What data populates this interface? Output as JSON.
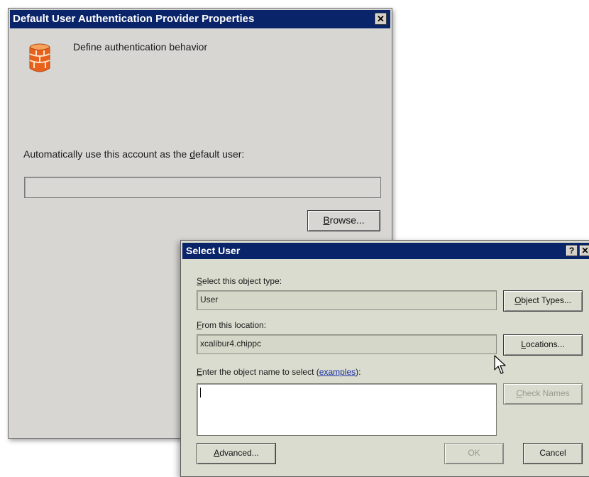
{
  "outer_dialog": {
    "title": "Default User Authentication Provider Properties",
    "close_glyph": "✕",
    "icon": "firewall-brick-icon",
    "description": "Define authentication behavior",
    "account_label_pre": "Automatically use this account as the ",
    "account_label_key": "d",
    "account_label_post": "efault user:",
    "account_value": "",
    "browse_key": "B",
    "browse_rest": "rowse..."
  },
  "select_user_dialog": {
    "title": "Select User",
    "help_glyph": "?",
    "close_glyph": "✕",
    "object_type_label_key": "S",
    "object_type_label_rest": "elect this object type:",
    "object_type_value": "User",
    "object_types_key": "O",
    "object_types_rest": "bject Types...",
    "location_label_key": "F",
    "location_label_rest": "rom this location:",
    "location_value": "xcalibur4.chippc",
    "locations_key": "L",
    "locations_rest": "ocations...",
    "name_label_key": "E",
    "name_label_rest": "nter the object name to select (",
    "examples_link": "examples",
    "name_label_end": "):",
    "name_value": "",
    "check_names_key": "C",
    "check_names_rest": "heck Names",
    "advanced_key": "A",
    "advanced_rest": "dvanced...",
    "ok_label": "OK",
    "cancel_label": "Cancel"
  },
  "colors": {
    "titlebar": "#0a246a",
    "outer_bg": "#d7d6d3",
    "inner_bg": "#d9dcce",
    "link": "#1a2ea8"
  }
}
